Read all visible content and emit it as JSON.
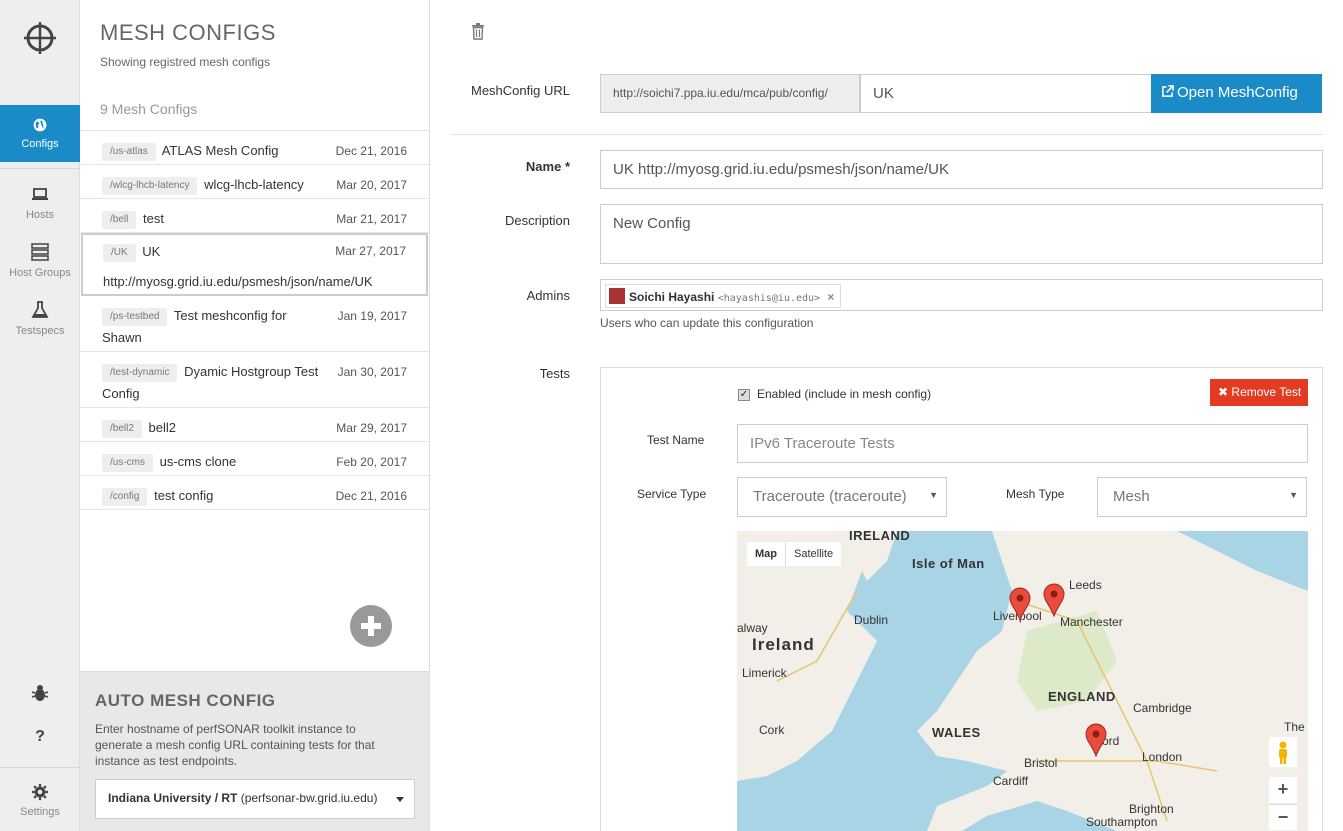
{
  "nav": {
    "items": [
      {
        "label": "Configs",
        "icon": "globe-icon",
        "active": true
      },
      {
        "label": "Hosts",
        "icon": "laptop-icon"
      },
      {
        "label": "Host Groups",
        "icon": "server-icon"
      },
      {
        "label": "Testspecs",
        "icon": "flask-icon"
      }
    ],
    "bottom": [
      {
        "icon": "bug-icon"
      },
      {
        "icon": "question-icon",
        "glyph": "?"
      },
      {
        "label": "Settings",
        "icon": "gear-icon"
      }
    ],
    "accent": "#1a8bc7"
  },
  "list": {
    "title": "MESH CONFIGS",
    "subtitle": "Showing registred mesh configs",
    "count": "9 Mesh Configs",
    "rows": [
      {
        "path": "/us-atlas",
        "name": "ATLAS Mesh Config",
        "date": "Dec 21, 2016"
      },
      {
        "path": "/wlcg-lhcb-latency",
        "name": "wlcg-lhcb-latency",
        "date": "Mar 20, 2017"
      },
      {
        "path": "/bell",
        "name": "test",
        "date": "Mar 21, 2017"
      },
      {
        "path": "/UK",
        "name": "UK",
        "extra": "http://myosg.grid.iu.edu/psmesh/json/name/UK",
        "date": "Mar 27, 2017",
        "selected": true
      },
      {
        "path": "/ps-testbed",
        "name": "Test meshconfig for",
        "extra": "Shawn",
        "date": "Jan 19, 2017"
      },
      {
        "path": "/test-dynamic",
        "name": "Dyamic Hostgroup Test",
        "extra": "Config",
        "date": "Jan 30, 2017"
      },
      {
        "path": "/bell2",
        "name": "bell2",
        "date": "Mar 29, 2017"
      },
      {
        "path": "/us-cms",
        "name": "us-cms clone",
        "date": "Feb 20, 2017"
      },
      {
        "path": "/config",
        "name": "test config",
        "date": "Dec 21, 2016"
      }
    ]
  },
  "auto": {
    "title": "AUTO MESH CONFIG",
    "description": "Enter hostname of perfSONAR toolkit instance to generate a mesh config URL containing tests for that instance as test endpoints.",
    "host_bold": "Indiana University / RT",
    "host_rest": " (perfsonar-bw.grid.iu.edu)"
  },
  "form": {
    "url_label": "MeshConfig URL",
    "url_prefix": "http://soichi7.ppa.iu.edu/mca/pub/config/",
    "url_value": "UK",
    "open_button": "Open MeshConfig",
    "name_label": "Name *",
    "name_value": "UK http://myosg.grid.iu.edu/psmesh/json/name/UK",
    "desc_label": "Description",
    "desc_value": "New Config",
    "admins_label": "Admins",
    "admin_name": "Soichi Hayashi",
    "admin_email": "<hayashis@iu.edu>",
    "admin_remove": "×",
    "admins_help": "Users who can update this configuration",
    "tests_label": "Tests"
  },
  "test": {
    "enabled_label": "Enabled (include in mesh config)",
    "enabled": true,
    "remove_button": "Remove Test",
    "name_label": "Test Name",
    "name_value": "IPv6 Traceroute Tests",
    "service_label": "Service Type",
    "service_value": "Traceroute (traceroute)",
    "mesh_label": "Mesh Type",
    "mesh_value": "Mesh"
  },
  "map": {
    "tabs": [
      "Map",
      "Satellite"
    ],
    "labels": [
      {
        "text": "IRELAND",
        "style": "b"
      },
      {
        "text": "Isle of Man",
        "style": "b"
      },
      {
        "text": "Leeds"
      },
      {
        "text": "alway"
      },
      {
        "text": "Dublin"
      },
      {
        "text": "Liverpool"
      },
      {
        "text": "Manchester"
      },
      {
        "text": "Ireland",
        "style": "big"
      },
      {
        "text": "Limerick"
      },
      {
        "text": "ENGLAND",
        "style": "b"
      },
      {
        "text": "Cambridge"
      },
      {
        "text": "WALES",
        "style": "b"
      },
      {
        "text": "The"
      },
      {
        "text": "Cork"
      },
      {
        "text": "ord"
      },
      {
        "text": "Bristol"
      },
      {
        "text": "London"
      },
      {
        "text": "Cardiff"
      },
      {
        "text": "Brighton"
      },
      {
        "text": "Southampton"
      }
    ],
    "zoom_in": "+",
    "zoom_out": "−",
    "land_color": "#f2efe9",
    "water_color": "#a9d4e6",
    "pin_color": "#e84c3d"
  }
}
